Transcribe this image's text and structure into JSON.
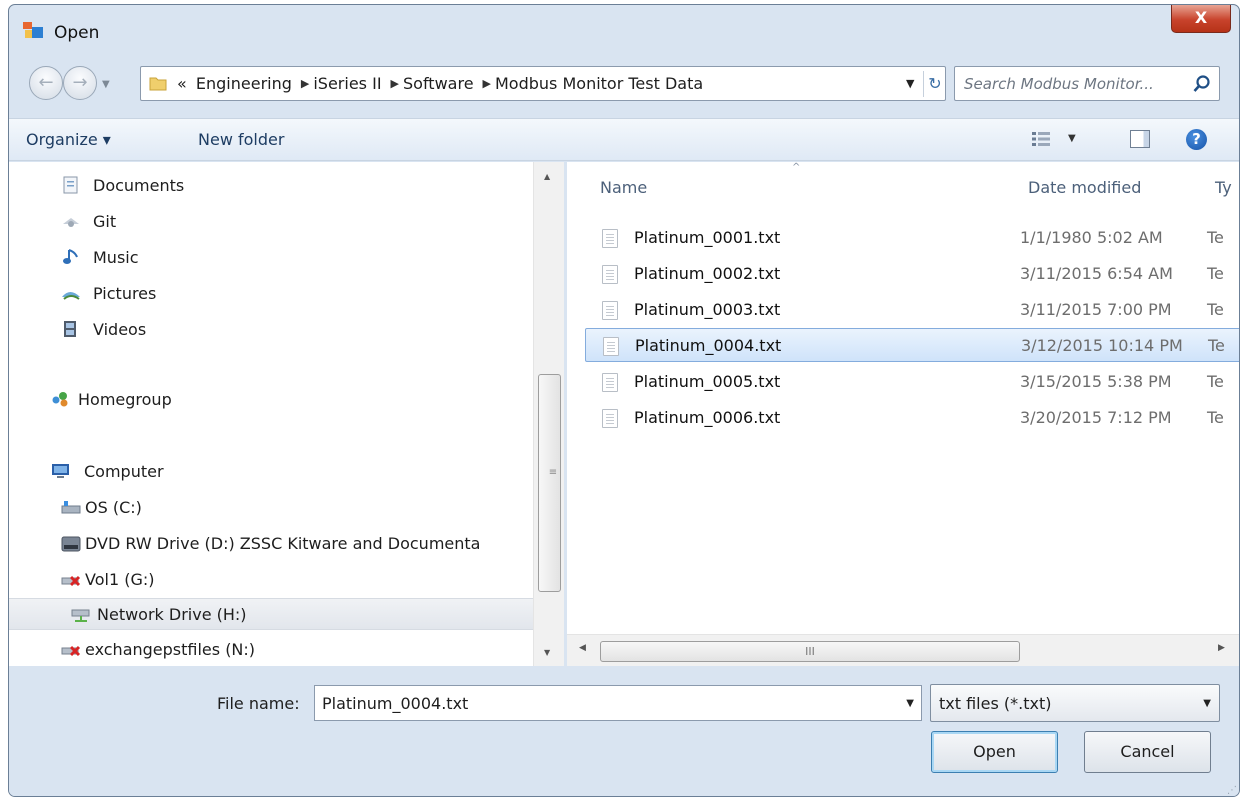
{
  "window": {
    "title": "Open",
    "close_glyph": "X"
  },
  "nav": {
    "back_glyph": "←",
    "forward_glyph": "→",
    "recent_glyph": "▼",
    "overflow_glyph": "«",
    "breadcrumb": [
      "Engineering",
      "iSeries II",
      "Software",
      "Modbus Monitor Test Data"
    ],
    "breadcrumb_separator": "▶",
    "dropdown_glyph": "▼",
    "refresh_glyph": "↻",
    "search_placeholder": "Search Modbus Monitor..."
  },
  "toolbar": {
    "organize_label": "Organize ▾",
    "new_folder_label": "New folder",
    "views_dropdown_glyph": "▼",
    "help_glyph": "?"
  },
  "sidebar": {
    "items": [
      {
        "label": "Documents",
        "icon": "documents-icon"
      },
      {
        "label": "Git",
        "icon": "git-icon"
      },
      {
        "label": "Music",
        "icon": "music-icon"
      },
      {
        "label": "Pictures",
        "icon": "pictures-icon"
      },
      {
        "label": "Videos",
        "icon": "videos-icon"
      },
      {
        "label": "Homegroup",
        "icon": "homegroup-icon"
      },
      {
        "label": "Computer",
        "icon": "computer-icon"
      },
      {
        "label": "OS (C:)",
        "icon": "drive-icon"
      },
      {
        "label": "DVD RW Drive (D:) ZSSC Kitware and Documenta",
        "icon": "dvd-drive-icon"
      },
      {
        "label": "Vol1 (G:)",
        "icon": "disconnected-drive-icon"
      },
      {
        "label": "Network Drive (H:)",
        "icon": "network-drive-icon"
      },
      {
        "label": "exchangepstfiles (N:)",
        "icon": "disconnected-drive-icon"
      }
    ],
    "scroll_up_glyph": "▲",
    "scroll_down_glyph": "▼",
    "scroll_grip_glyph": "≡"
  },
  "file_list": {
    "columns": [
      "Name",
      "Date modified",
      "Ty"
    ],
    "sort_glyph": "^",
    "rows": [
      {
        "name": "Platinum_0001.txt",
        "date": "1/1/1980 5:02 AM",
        "type": "Te"
      },
      {
        "name": "Platinum_0002.txt",
        "date": "3/11/2015 6:54 AM",
        "type": "Te"
      },
      {
        "name": "Platinum_0003.txt",
        "date": "3/11/2015 7:00 PM",
        "type": "Te"
      },
      {
        "name": "Platinum_0004.txt",
        "date": "3/12/2015 10:14 PM",
        "type": "Te"
      },
      {
        "name": "Platinum_0005.txt",
        "date": "3/15/2015 5:38 PM",
        "type": "Te"
      },
      {
        "name": "Platinum_0006.txt",
        "date": "3/20/2015 7:12 PM",
        "type": "Te"
      }
    ],
    "selected_row": "Platinum_0004.txt",
    "hscroll_left_glyph": "◀",
    "hscroll_right_glyph": "▶",
    "hscroll_grip_glyph": "III"
  },
  "footer": {
    "file_name_label": "File name:",
    "file_name_value": "Platinum_0004.txt",
    "file_name_drop_glyph": "▼",
    "file_type_value": "txt files (*.txt)",
    "file_type_drop_glyph": "▼",
    "open_label": "Open",
    "cancel_label": "Cancel",
    "size_grip_glyph": "⋰"
  },
  "colors": {
    "window_bg": "#d9e4f1",
    "selection_bg": "#cfe3fa",
    "selection_border": "#84acdd",
    "close_button": "#c8432c"
  }
}
